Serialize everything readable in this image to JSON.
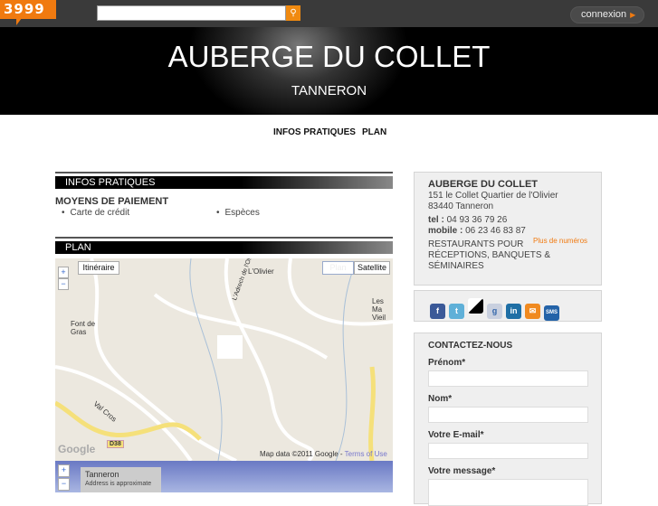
{
  "topbar": {
    "logo": "3999",
    "search_placeholder": "",
    "search_icon": "magnifier-icon",
    "connexion": "connexion"
  },
  "banner": {
    "title": "AUBERGE DU COLLET",
    "subtitle": "TANNERON"
  },
  "nav": [
    "INFOS PRATIQUES",
    "PLAN"
  ],
  "infos": {
    "header": "INFOS PRATIQUES",
    "payment_title": "MOYENS DE PAIEMENT",
    "payments": [
      "Carte de crédit",
      "Espèces"
    ]
  },
  "plan": {
    "header": "PLAN",
    "itineraire": "Itinéraire",
    "plan_btn": "Plan",
    "satellite": "Satellite",
    "labels": [
      "L'Olivier",
      "Font de Gras",
      "Les Ma Vieil",
      "L'Adrech de l'Olivier",
      "Val Cros",
      "D38"
    ],
    "google": "Google",
    "attribution": "Map data ©2011 Google - ",
    "terms": "Terms of Use",
    "zoom_in": "+",
    "zoom_out": "−",
    "street_place": "Tanneron",
    "street_note": "Address is approximate"
  },
  "business": {
    "name": "AUBERGE DU COLLET",
    "address1": "151 le Collet Quartier de l'Olivier",
    "address2": "83440 Tanneron",
    "tel_label": "tel :",
    "tel": "04 93 36 79 26",
    "mobile_label": "mobile :",
    "mobile": "06 23 46 83 87",
    "more_numbers": "Plus de numéros",
    "category": "RESTAURANTS POUR RÉCEPTIONS, BANQUETS & SÉMINAIRES"
  },
  "share": [
    {
      "icon": "facebook-icon",
      "label": "f",
      "color": "#3b5998"
    },
    {
      "icon": "twitter-icon",
      "label": "t",
      "color": "#5fb0d8"
    },
    {
      "icon": "delicious-icon",
      "label": "",
      "color": "#3271cb"
    },
    {
      "icon": "google-icon",
      "label": "g",
      "color": "#c9d0df"
    },
    {
      "icon": "linkedin-icon",
      "label": "in",
      "color": "#1f6fa5"
    },
    {
      "icon": "email-icon",
      "label": "✉",
      "color": "#f08a20"
    },
    {
      "icon": "sms-icon",
      "label": "SMS",
      "color": "#2463a8"
    }
  ],
  "contact": {
    "title": "CONTACTEZ-NOUS",
    "fields": [
      "Prénom*",
      "Nom*",
      "Votre E-mail*",
      "Votre message*"
    ]
  }
}
